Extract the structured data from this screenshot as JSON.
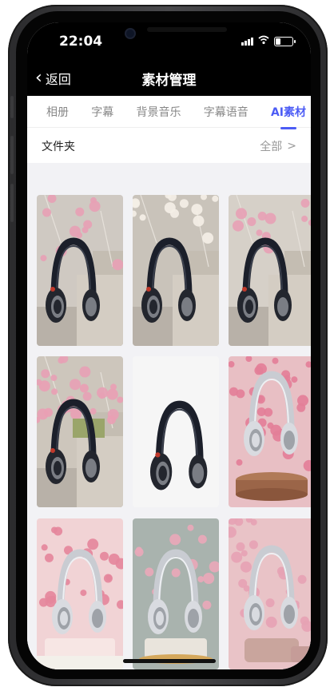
{
  "status_bar": {
    "time": "22:04"
  },
  "nav": {
    "back_label": "返回",
    "title": "素材管理"
  },
  "tabs": [
    {
      "label": "相册",
      "active": false
    },
    {
      "label": "字幕",
      "active": false
    },
    {
      "label": "背景音乐",
      "active": false
    },
    {
      "label": "字幕语音",
      "active": false
    },
    {
      "label": "AI素材",
      "active": true
    }
  ],
  "folder": {
    "label": "文件夹",
    "filter_label": "全部",
    "filter_chevron": ">"
  },
  "colors": {
    "accent": "#4c5cf5",
    "header_bg": "#000000"
  },
  "thumbnails": [
    {
      "headphone": "black",
      "scene": "marble-steps-pink-flowers",
      "bg": "#cfc9c2"
    },
    {
      "headphone": "black",
      "scene": "marble-steps-white-flowers",
      "bg": "#c9c3ba"
    },
    {
      "headphone": "black",
      "scene": "marble-wall-pink-flowers",
      "bg": "#d6d0c8"
    },
    {
      "headphone": "black",
      "scene": "steps-pink-bouquet",
      "bg": "#cdc6bc"
    },
    {
      "headphone": "black",
      "scene": "plain-white",
      "bg": "#f6f6f6"
    },
    {
      "headphone": "silver",
      "scene": "pink-roses-bronze-stand",
      "bg": "#e8bfc4"
    },
    {
      "headphone": "silver",
      "scene": "pink-gerberas-cake",
      "bg": "#f1d3d5"
    },
    {
      "headphone": "silver",
      "scene": "flowers-candles",
      "bg": "#a9b3ae"
    },
    {
      "headphone": "silver",
      "scene": "pink-carnations-stones",
      "bg": "#e9c3c7"
    }
  ]
}
